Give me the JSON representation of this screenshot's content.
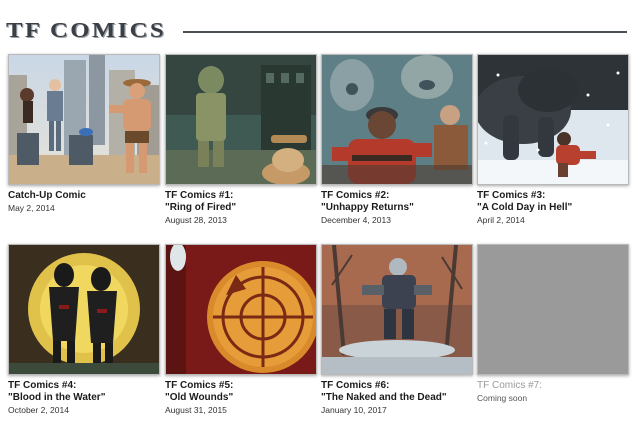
{
  "header": {
    "title": "TF COMICS"
  },
  "comics": [
    {
      "title": "Catch-Up Comic",
      "subtitle": "",
      "date": "May 2, 2014",
      "thumbnail": "catch-up-comic-thumbnail"
    },
    {
      "title": "TF Comics #1:",
      "subtitle": "\"Ring of Fired\"",
      "date": "August 28, 2013",
      "thumbnail": "ring-of-fired-thumbnail"
    },
    {
      "title": "TF Comics #2:",
      "subtitle": "\"Unhappy Returns\"",
      "date": "December 4, 2013",
      "thumbnail": "unhappy-returns-thumbnail"
    },
    {
      "title": "TF Comics #3:",
      "subtitle": "\"A Cold Day in Hell\"",
      "date": "April 2, 2014",
      "thumbnail": "a-cold-day-in-hell-thumbnail"
    },
    {
      "title": "TF Comics #4:",
      "subtitle": "\"Blood in the Water\"",
      "date": "October 2, 2014",
      "thumbnail": "blood-in-the-water-thumbnail"
    },
    {
      "title": "TF Comics #5:",
      "subtitle": "\"Old Wounds\"",
      "date": "August 31, 2015",
      "thumbnail": "old-wounds-thumbnail"
    },
    {
      "title": "TF Comics #6:",
      "subtitle": "\"The Naked and the Dead\"",
      "date": "January 10, 2017",
      "thumbnail": "the-naked-and-the-dead-thumbnail"
    },
    {
      "title": "TF Comics #7:",
      "subtitle": "",
      "date": "Coming soon",
      "thumbnail": "coming-soon-placeholder"
    }
  ]
}
